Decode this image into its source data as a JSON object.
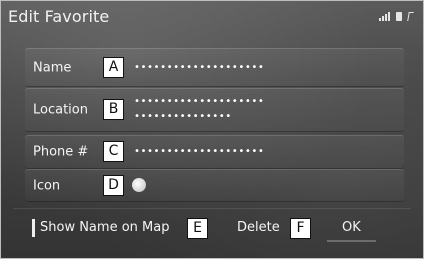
{
  "window": {
    "title": "Edit Favorite"
  },
  "status_icons": [
    "signal-icon",
    "battery-icon",
    "bluetooth-icon"
  ],
  "fields": {
    "name": {
      "label": "Name",
      "callout": "A",
      "value": "••••••••••••••••••••"
    },
    "location": {
      "label": "Location",
      "callout": "B",
      "value_line1": "••••••••••••••••••••",
      "value_line2": "•••••••••••••••"
    },
    "phone": {
      "label": "Phone #",
      "callout": "C",
      "value": "••••••••••••••••••••"
    },
    "icon": {
      "label": "Icon",
      "callout": "D",
      "icon_name": "circle-marker-icon"
    }
  },
  "bottom": {
    "show_name_label": "Show Name on Map",
    "show_name_callout": "E",
    "delete_label": "Delete",
    "delete_callout": "F",
    "ok_label": "OK"
  }
}
